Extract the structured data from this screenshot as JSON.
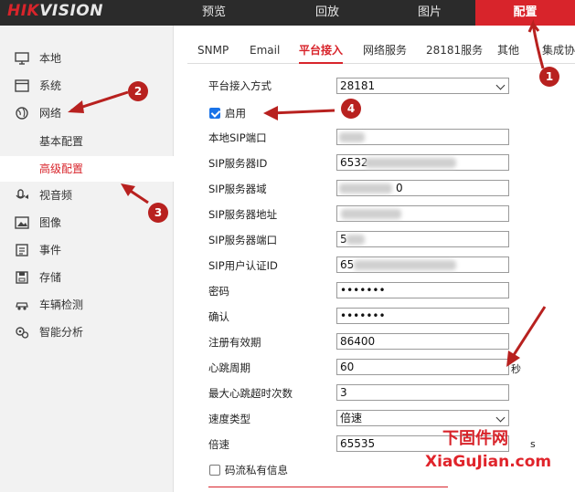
{
  "brand": {
    "logo_red": "HIK",
    "logo_white": "VISION"
  },
  "topnav": {
    "items": [
      {
        "label": "预览"
      },
      {
        "label": "回放"
      },
      {
        "label": "图片"
      },
      {
        "label": "配置",
        "active": true
      }
    ]
  },
  "sidebar": {
    "items": [
      {
        "label": "本地",
        "icon": "monitor-icon"
      },
      {
        "label": "系统",
        "icon": "system-icon"
      },
      {
        "label": "网络",
        "icon": "globe-icon"
      },
      {
        "label": "基本配置",
        "sub": true
      },
      {
        "label": "高级配置",
        "sub": true,
        "active": true
      },
      {
        "label": "视音频",
        "icon": "microphone-icon"
      },
      {
        "label": "图像",
        "icon": "image-icon"
      },
      {
        "label": "事件",
        "icon": "event-icon"
      },
      {
        "label": "存储",
        "icon": "storage-icon"
      },
      {
        "label": "车辆检测",
        "icon": "vehicle-icon"
      },
      {
        "label": "智能分析",
        "icon": "analysis-icon"
      }
    ]
  },
  "tabs": [
    {
      "label": "SNMP"
    },
    {
      "label": "Email"
    },
    {
      "label": "平台接入",
      "active": true
    },
    {
      "label": "网络服务"
    },
    {
      "label": "28181服务"
    },
    {
      "label": "其他"
    },
    {
      "label": "集成协议"
    }
  ],
  "form": {
    "access_mode": {
      "label": "平台接入方式",
      "value": "28181"
    },
    "enable": {
      "label": "启用",
      "checked": true
    },
    "local_sip_port": {
      "label": "本地SIP端口",
      "value": ""
    },
    "sip_server_id": {
      "label": "SIP服务器ID",
      "value": "6532"
    },
    "sip_server_domain": {
      "label": "SIP服务器域",
      "value": "0"
    },
    "sip_server_address": {
      "label": "SIP服务器地址",
      "value": ""
    },
    "sip_server_port": {
      "label": "SIP服务器端口",
      "value": "5"
    },
    "sip_user_auth_id": {
      "label": "SIP用户认证ID",
      "value": "65"
    },
    "password": {
      "label": "密码",
      "value": "•••••••"
    },
    "confirm": {
      "label": "确认",
      "value": "•••••••"
    },
    "register_validity": {
      "label": "注册有效期",
      "value": "86400"
    },
    "heartbeat_period": {
      "label": "心跳周期",
      "value": "60",
      "unit": "秒"
    },
    "max_heartbeat_timeout": {
      "label": "最大心跳超时次数",
      "value": "3"
    },
    "speed_type": {
      "label": "速度类型",
      "value": "倍速"
    },
    "multiplier": {
      "label": "倍速",
      "value": "65535",
      "unit": "s"
    },
    "stream_private_info": {
      "label": "码流私有信息",
      "checked": false
    }
  },
  "annotations": [
    "1",
    "2",
    "3",
    "4"
  ],
  "watermark": {
    "cn": "下固件网",
    "en": "XiaGuJian.com"
  },
  "colors": {
    "accent": "#d8242b",
    "marker": "#b8211f",
    "topbar": "#2b2b2b",
    "checkbox": "#1a73e8"
  }
}
